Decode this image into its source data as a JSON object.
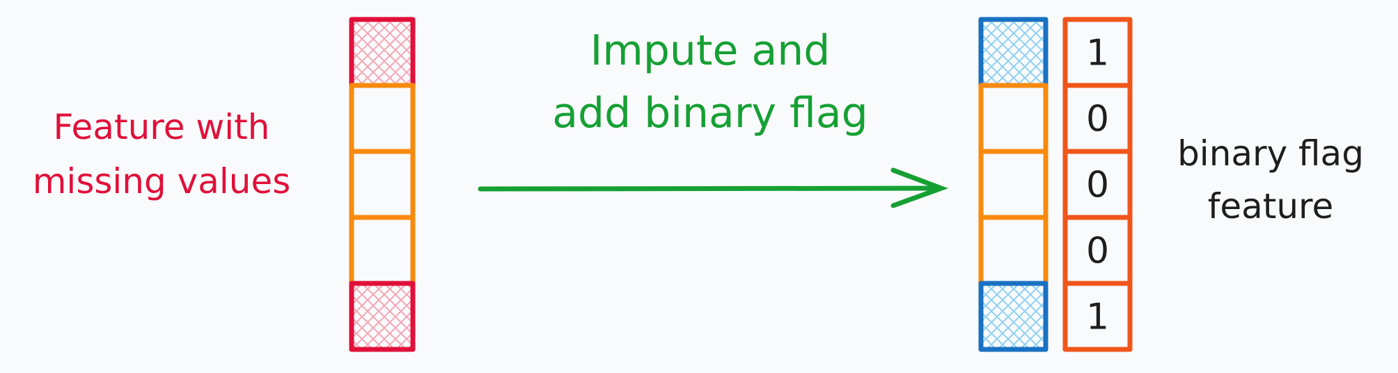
{
  "labels": {
    "left": [
      "Feature with",
      "missing values"
    ],
    "middle": [
      "Impute and",
      "add binary flag"
    ],
    "right": [
      "binary flag",
      "feature"
    ]
  },
  "original_column": {
    "cells": [
      {
        "state": "missing"
      },
      {
        "state": "present"
      },
      {
        "state": "present"
      },
      {
        "state": "present"
      },
      {
        "state": "missing"
      }
    ]
  },
  "imputed_column": {
    "cells": [
      {
        "state": "imputed"
      },
      {
        "state": "present"
      },
      {
        "state": "present"
      },
      {
        "state": "present"
      },
      {
        "state": "imputed"
      }
    ]
  },
  "flag_column": {
    "values": [
      "1",
      "0",
      "0",
      "0",
      "1"
    ]
  },
  "colors": {
    "background": "#f9fafc",
    "missing_border": "#e0103a",
    "missing_hatch": "#f4a6b3",
    "present_border": "#f78a0f",
    "imputed_border": "#1971c2",
    "imputed_hatch": "#8fd0f2",
    "flag_border": "#f0561a",
    "left_text": "#e0103a",
    "middle_text": "#16a034",
    "arrow": "#16a034",
    "right_text": "#1e1e1e"
  }
}
